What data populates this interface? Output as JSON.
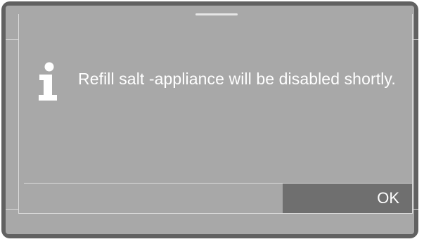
{
  "dialog": {
    "icon": "info-icon",
    "message": "Refill salt -appliance will be disabled shortly."
  },
  "actions": {
    "ok_label": "OK"
  },
  "colors": {
    "frame": "#616161",
    "screen": "#a8a8a8",
    "button": "#6f6f6f",
    "text": "#ffffff"
  }
}
